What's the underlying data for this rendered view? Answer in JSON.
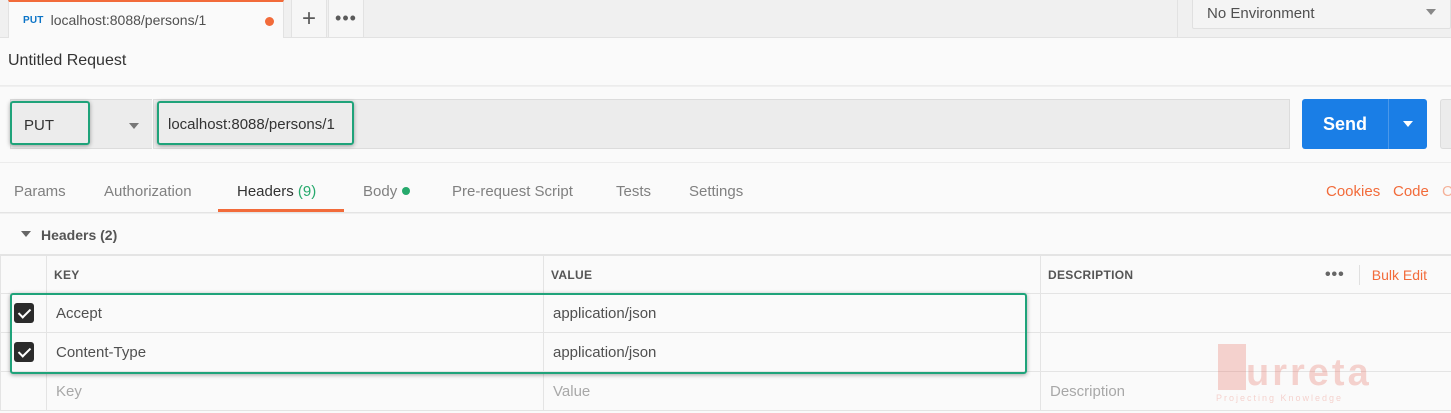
{
  "tab": {
    "method": "PUT",
    "title": "localhost:8088/persons/1",
    "plus_icon": "+",
    "more_icon": "•••"
  },
  "environment": {
    "selected": "No Environment"
  },
  "request": {
    "title": "Untitled Request",
    "method": "PUT",
    "url": "localhost:8088/persons/1",
    "send_label": "Send"
  },
  "tabs": [
    {
      "label": "Params"
    },
    {
      "label": "Authorization"
    },
    {
      "label": "Headers",
      "count": "(9)"
    },
    {
      "label": "Body"
    },
    {
      "label": "Pre-request Script"
    },
    {
      "label": "Tests"
    },
    {
      "label": "Settings"
    }
  ],
  "links": {
    "cookies": "Cookies",
    "code": "Code",
    "comments": "C"
  },
  "headers": {
    "section_title": "Headers (2)",
    "columns": {
      "key": "KEY",
      "value": "VALUE",
      "description": "DESCRIPTION"
    },
    "more_icon": "•••",
    "bulk_edit": "Bulk Edit",
    "rows": [
      {
        "key": "Accept",
        "value": "application/json",
        "description": ""
      },
      {
        "key": "Content-Type",
        "value": "application/json",
        "description": ""
      }
    ],
    "placeholder": {
      "key": "Key",
      "value": "Value",
      "description": "Description"
    }
  },
  "watermark": {
    "text": "urreta",
    "subtitle": "Projecting Knowledge"
  },
  "colors": {
    "accent": "#f26b3a",
    "send": "#1a7ee6",
    "method": "#0b74c7",
    "highlight": "#1fa37a",
    "count": "#26a96c"
  }
}
